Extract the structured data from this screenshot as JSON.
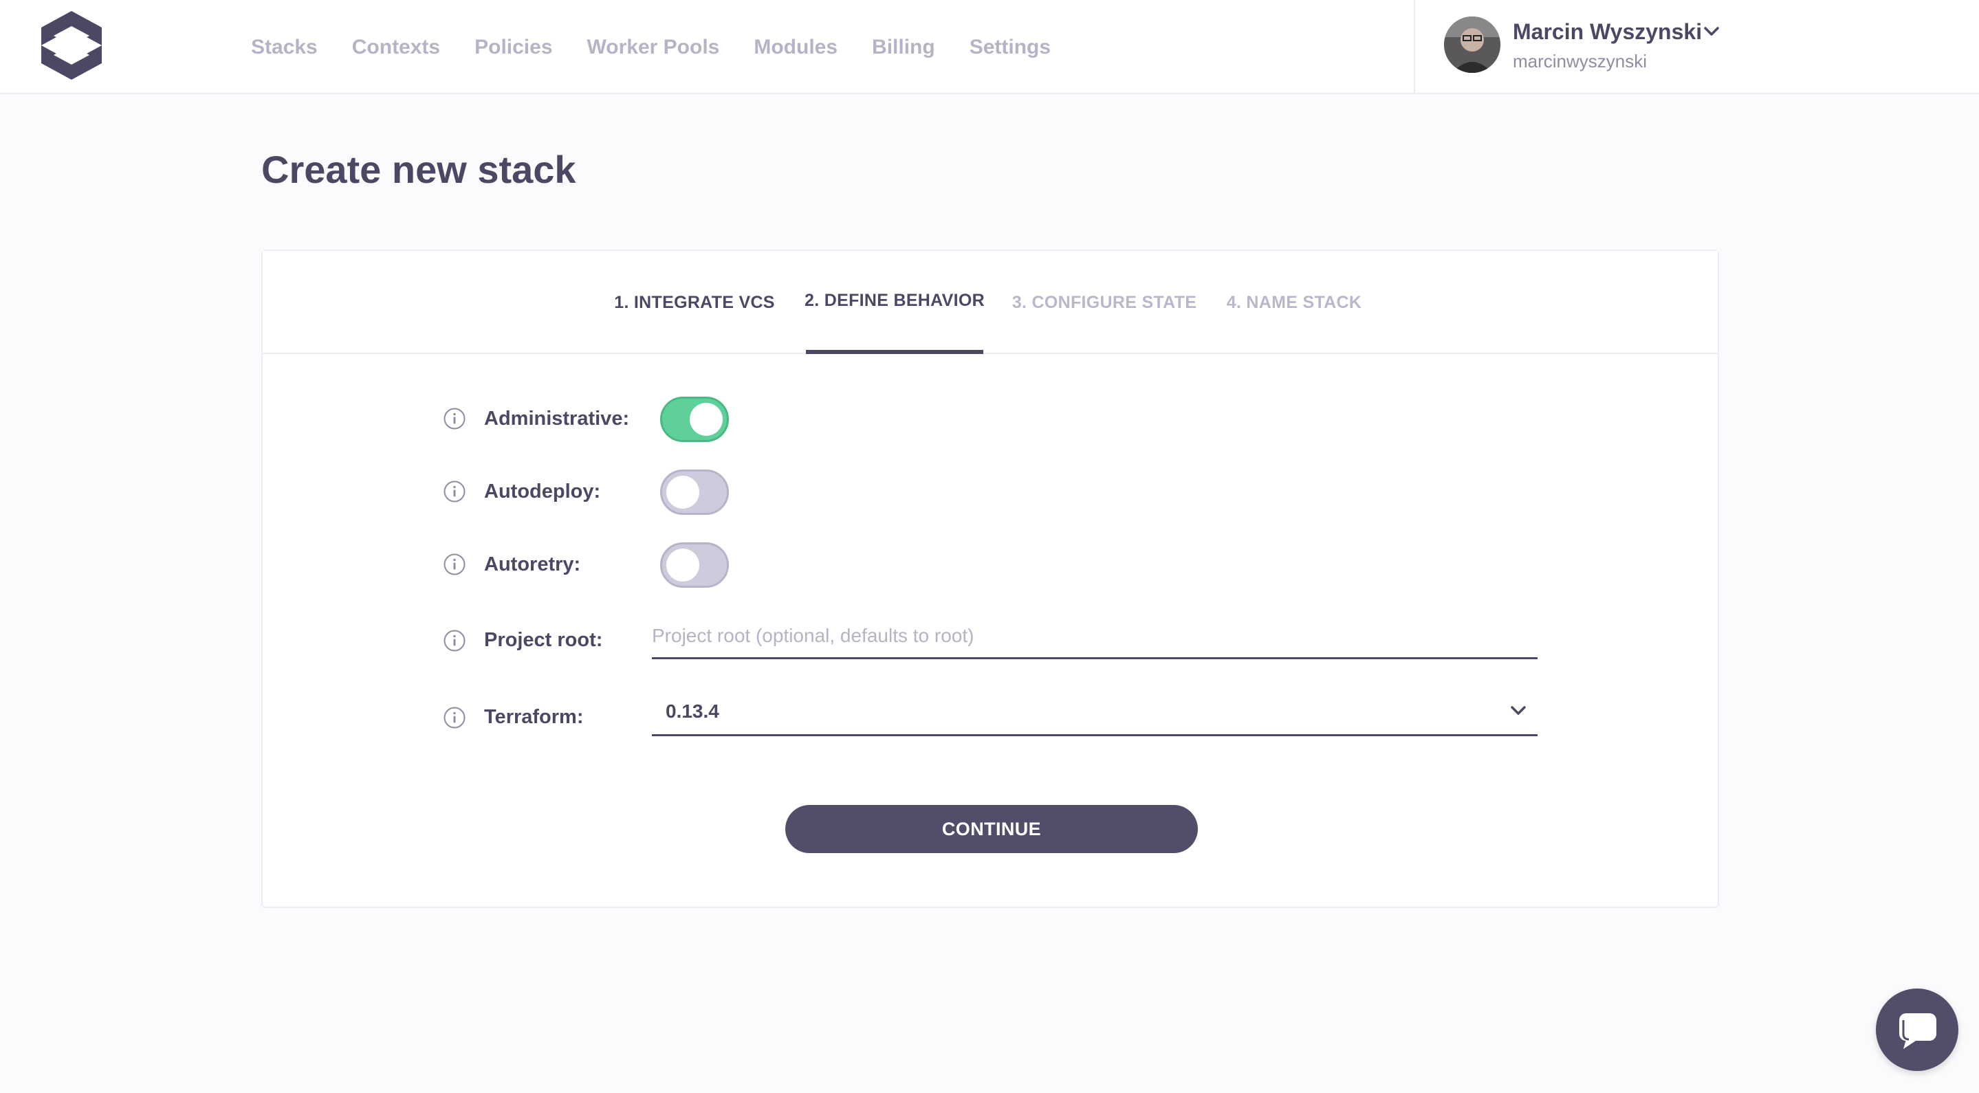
{
  "nav": {
    "items": [
      {
        "label": "Stacks"
      },
      {
        "label": "Contexts"
      },
      {
        "label": "Policies"
      },
      {
        "label": "Worker Pools"
      },
      {
        "label": "Modules"
      },
      {
        "label": "Billing"
      },
      {
        "label": "Settings"
      }
    ]
  },
  "user": {
    "name": "Marcin Wyszynski",
    "handle": "marcinwyszynski"
  },
  "page": {
    "title": "Create new stack"
  },
  "steps": [
    {
      "label": "1. INTEGRATE VCS",
      "state": "done"
    },
    {
      "label": "2. DEFINE BEHAVIOR",
      "state": "active"
    },
    {
      "label": "3. CONFIGURE STATE",
      "state": "todo"
    },
    {
      "label": "4. NAME STACK",
      "state": "todo"
    }
  ],
  "form": {
    "administrative": {
      "label": "Administrative:",
      "enabled": true
    },
    "autodeploy": {
      "label": "Autodeploy:",
      "enabled": false
    },
    "autoretry": {
      "label": "Autoretry:",
      "enabled": false
    },
    "project_root": {
      "label": "Project root:",
      "value": "",
      "placeholder": "Project root (optional, defaults to root)"
    },
    "terraform": {
      "label": "Terraform:",
      "value": "0.13.4"
    },
    "continue_label": "CONTINUE"
  },
  "colors": {
    "accent": "#514e69",
    "toggle_on": "#5fd09a",
    "toggle_off": "#cecbdd",
    "nav_inactive": "#b5b3c6"
  },
  "icons": {
    "logo": "spacelift-logo",
    "info": "info-icon",
    "chevron": "chevron-down-icon",
    "chat": "chat-bubble-icon"
  }
}
